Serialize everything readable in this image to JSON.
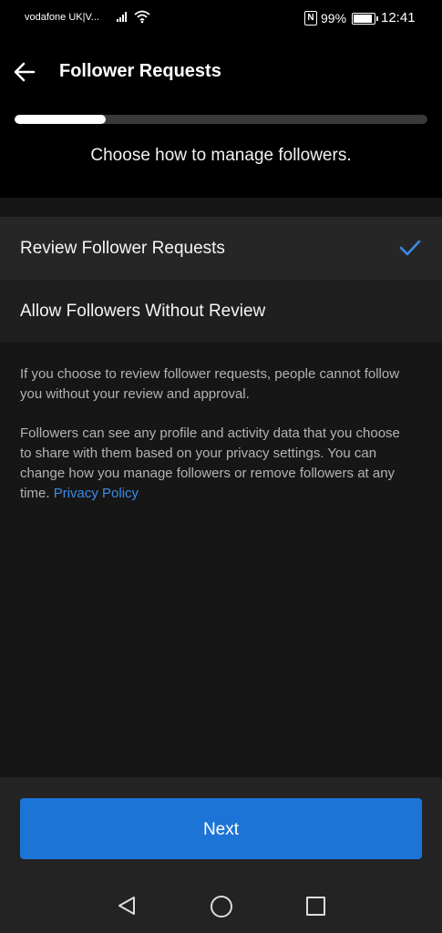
{
  "status_bar": {
    "carrier": "vodafone UK|V...",
    "battery_text": "99%",
    "battery_level": 0.99,
    "time": "12:41",
    "icons": [
      "signal-icon",
      "wifi-icon",
      "nfc-icon",
      "battery-icon"
    ]
  },
  "header": {
    "title": "Follower Requests",
    "progress": 0.22,
    "subtitle": "Choose how to manage followers."
  },
  "options": [
    {
      "label": "Review Follower Requests",
      "selected": true
    },
    {
      "label": "Allow Followers Without Review",
      "selected": false
    }
  ],
  "description": {
    "paragraph1": "If you choose to review follower requests, people cannot follow you without your review and approval.",
    "paragraph2": "Followers can see any profile and activity data that you choose to share with them based on your privacy settings. You can change how you manage followers or remove followers at any time.",
    "link": "Privacy Policy"
  },
  "footer": {
    "next_label": "Next"
  },
  "colors": {
    "accent": "#1c74d6",
    "link": "#3d8be6",
    "check": "#3d8be6"
  }
}
